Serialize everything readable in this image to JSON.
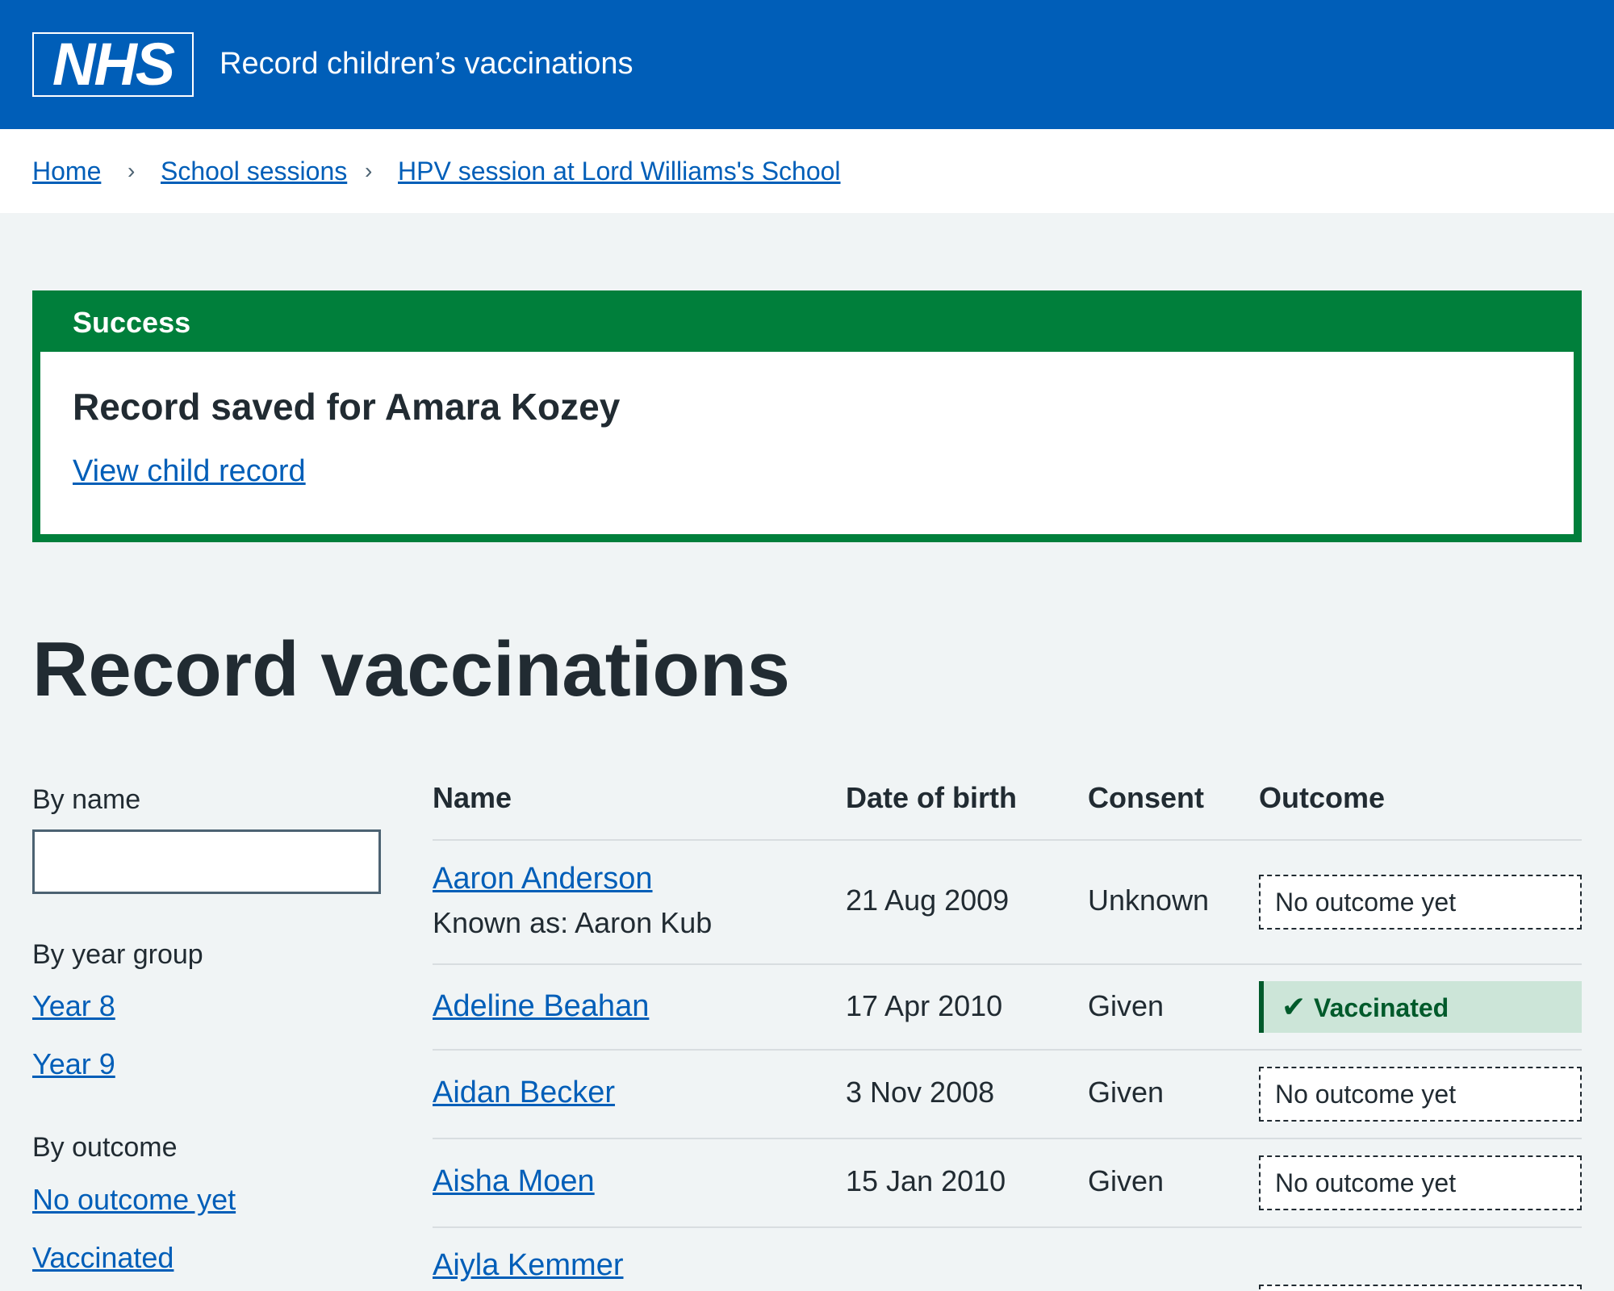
{
  "header": {
    "logo_text": "NHS",
    "service_name": "Record children’s vaccinations"
  },
  "breadcrumb": {
    "items": [
      "Home",
      "School sessions",
      "HPV session at Lord Williams's School"
    ],
    "separator_icon": "chevron-right"
  },
  "banner": {
    "title": "Success",
    "heading": "Record saved for Amara Kozey",
    "link": "View child record"
  },
  "page_title": "Record vaccinations",
  "filters": {
    "by_name_label": "By name",
    "by_name_value": "",
    "by_year_label": "By year group",
    "year_options": [
      "Year 8",
      "Year 9"
    ],
    "by_outcome_label": "By outcome",
    "outcome_options": [
      "No outcome yet",
      "Vaccinated"
    ]
  },
  "table": {
    "headers": [
      "Name",
      "Date of birth",
      "Consent",
      "Outcome"
    ],
    "rows": [
      {
        "name": "Aaron Anderson",
        "known_as": "Known as: Aaron Kub",
        "dob": "21 Aug 2009",
        "consent": "Unknown",
        "outcome": "No outcome yet"
      },
      {
        "name": "Adeline Beahan",
        "dob": "17 Apr 2010",
        "consent": "Given",
        "outcome": "Vaccinated"
      },
      {
        "name": "Aidan Becker",
        "dob": "3 Nov 2008",
        "consent": "Given",
        "outcome": "No outcome yet"
      },
      {
        "name": "Aisha Moen",
        "dob": "15 Jan 2010",
        "consent": "Given",
        "outcome": "No outcome yet"
      },
      {
        "name": "Aiyla Kemmer"
      }
    ]
  },
  "colors": {
    "nhs_blue": "#005eb8",
    "success_green": "#007f3b",
    "vaccinated_tag_bg": "#cce5d8",
    "vaccinated_tag_text": "#005a2b",
    "page_bg": "#f0f4f5"
  }
}
